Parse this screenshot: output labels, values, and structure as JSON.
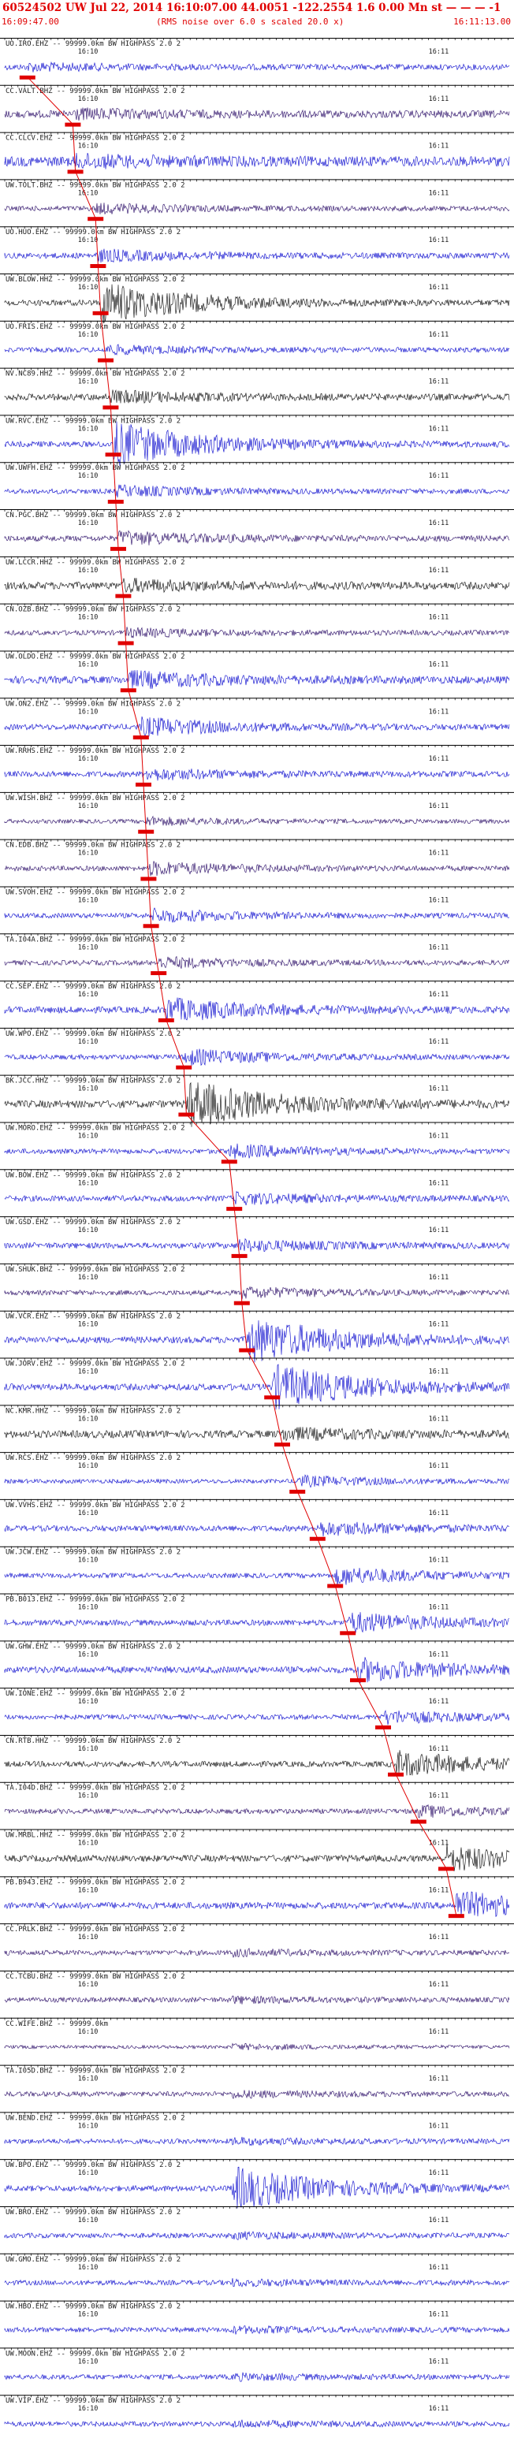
{
  "header": {
    "title": "60524502 UW Jul 22, 2014 16:10:07.00    44.0051 -122.2554  1.6 0.00 Mn st  — — — -1",
    "subtitle": "(RMS noise over 6.0 s scaled 20.0 x)",
    "start_time": "16:09:47.00",
    "end_time": "16:11:13.00"
  },
  "colors": {
    "trace_a": "#0000cc",
    "trace_b": "#200060",
    "trace_c": "#000000",
    "pick": "#e00000",
    "label": "#222222"
  },
  "chart_data": {
    "type": "line",
    "title": "60524502 UW Jul 22, 2014 16:10:07.00    44.0051 -122.2554  1.6 0.00 Mn st  — — — -1",
    "x_range": [
      "16:09:47.00",
      "16:11:13.00"
    ],
    "tick_labels": [
      "16:10",
      "16:11"
    ],
    "stations": [
      {
        "label": "UO.IRO.EHZ -- 99999.0km BW  HIGHPASS  2.0  2",
        "amp": 0.35,
        "burst": 0.12,
        "pick": 0.045,
        "color": "a"
      },
      {
        "label": "CC.VALT.BHZ -- 99999.0km BW  HIGHPASS  2.0  2",
        "amp": 0.45,
        "burst": 0.16,
        "pick": 0.135,
        "color": "b"
      },
      {
        "label": "CC.CLCV.EHZ -- 99999.0km BW  HIGHPASS  2.0  2",
        "amp": 0.6,
        "burst": 0.18,
        "pick": 0.14,
        "color": "a"
      },
      {
        "label": "UW.TOLT.BHZ -- 99999.0km BW  HIGHPASS  2.0  2",
        "amp": 0.3,
        "burst": 0.17,
        "pick": 0.18,
        "color": "b"
      },
      {
        "label": "UO.HUO.EHZ -- 99999.0km BW  HIGHPASS  2.0  2",
        "amp": 0.35,
        "burst": 0.2,
        "pick": 0.185,
        "color": "a"
      },
      {
        "label": "UW.BLOW.HHZ -- 99999.0km BW  HIGHPASS  2.0  2",
        "amp": 0.35,
        "burst": 0.85,
        "pick": 0.19,
        "color": "c"
      },
      {
        "label": "UO.FRIS.EHZ -- 99999.0km BW  HIGHPASS  2.0  2",
        "amp": 0.3,
        "burst": 0.15,
        "pick": 0.2,
        "color": "a"
      },
      {
        "label": "NV.NC89.HHZ -- 99999.0km BW  HIGHPASS  2.0  2",
        "amp": 0.4,
        "burst": 0.2,
        "pick": 0.21,
        "color": "c"
      },
      {
        "label": "UW.RVC.EHZ -- 99999.0km BW  HIGHPASS  2.0  2",
        "amp": 0.35,
        "burst": 0.9,
        "pick": 0.215,
        "color": "a"
      },
      {
        "label": "UW.UWFH.EHZ -- 99999.0km BW  HIGHPASS  2.0  2",
        "amp": 0.3,
        "burst": 0.2,
        "pick": 0.22,
        "color": "a"
      },
      {
        "label": "CN.PGC.BHZ -- 99999.0km BW  HIGHPASS  2.0  2",
        "amp": 0.35,
        "burst": 0.25,
        "pick": 0.225,
        "color": "b"
      },
      {
        "label": "UW.LCCR.HHZ -- 99999.0km BW  HIGHPASS  2.0  2",
        "amp": 0.45,
        "burst": 0.2,
        "pick": 0.235,
        "color": "c"
      },
      {
        "label": "CN.OZB.BHZ -- 99999.0km BW  HIGHPASS  2.0  2",
        "amp": 0.3,
        "burst": 0.15,
        "pick": 0.24,
        "color": "b"
      },
      {
        "label": "UW.OLDO.EHZ -- 99999.0km BW  HIGHPASS  2.0  2",
        "amp": 0.45,
        "burst": 0.3,
        "pick": 0.245,
        "color": "a"
      },
      {
        "label": "UW.ON2.EHZ -- 99999.0km BW  HIGHPASS  2.0  2",
        "amp": 0.35,
        "burst": 0.35,
        "pick": 0.27,
        "color": "a"
      },
      {
        "label": "UW.RRHS.EHZ -- 99999.0km BW  HIGHPASS  2.0  2",
        "amp": 0.35,
        "burst": 0.2,
        "pick": 0.275,
        "color": "a"
      },
      {
        "label": "UW.WISH.BHZ -- 99999.0km BW  HIGHPASS  2.0  2",
        "amp": 0.25,
        "burst": 0.15,
        "pick": 0.28,
        "color": "b"
      },
      {
        "label": "CN.EDB.BHZ -- 99999.0km BW  HIGHPASS  2.0  2",
        "amp": 0.3,
        "burst": 0.25,
        "pick": 0.285,
        "color": "b"
      },
      {
        "label": "UW.SVOH.EHZ -- 99999.0km BW  HIGHPASS  2.0  2",
        "amp": 0.3,
        "burst": 0.25,
        "pick": 0.29,
        "color": "a"
      },
      {
        "label": "TA.I04A.BHZ -- 99999.0km BW  HIGHPASS  2.0  2",
        "amp": 0.3,
        "burst": 0.2,
        "pick": 0.305,
        "color": "b"
      },
      {
        "label": "CC.SEP.EHZ -- 99999.0km BW  HIGHPASS  2.0  2",
        "amp": 0.4,
        "burst": 0.45,
        "pick": 0.32,
        "color": "a"
      },
      {
        "label": "UW.WPO.EHZ -- 99999.0km BW  HIGHPASS  2.0  2",
        "amp": 0.3,
        "burst": 0.3,
        "pick": 0.355,
        "color": "a"
      },
      {
        "label": "BK.JCC.HHZ -- 99999.0km BW  HIGHPASS  2.0  2",
        "amp": 0.45,
        "burst": 0.95,
        "pick": 0.36,
        "color": "c"
      },
      {
        "label": "UW.MORO.EHZ -- 99999.0km BW  HIGHPASS  2.0  2",
        "amp": 0.3,
        "burst": 0.25,
        "pick": 0.445,
        "color": "a"
      },
      {
        "label": "UW.BOW.EHZ -- 99999.0km BW  HIGHPASS  2.0  2",
        "amp": 0.35,
        "burst": 0.2,
        "pick": 0.455,
        "color": "a"
      },
      {
        "label": "UW.GSD.EHZ -- 99999.0km BW  HIGHPASS  2.0  2",
        "amp": 0.35,
        "burst": 0.2,
        "pick": 0.465,
        "color": "a"
      },
      {
        "label": "UW.SHUK.BHZ -- 99999.0km BW  HIGHPASS  2.0  2",
        "amp": 0.3,
        "burst": 0.2,
        "pick": 0.47,
        "color": "b"
      },
      {
        "label": "UW.VCR.EHZ -- 99999.0km BW  HIGHPASS  2.0  2",
        "amp": 0.4,
        "burst": 0.95,
        "pick": 0.48,
        "color": "a"
      },
      {
        "label": "UW.JORV.EHZ -- 99999.0km BW  HIGHPASS  2.0  2",
        "amp": 0.4,
        "burst": 0.9,
        "pick": 0.53,
        "color": "a"
      },
      {
        "label": "NC.KMR.HHZ -- 99999.0km BW  HIGHPASS  2.0  2",
        "amp": 0.45,
        "burst": 0.2,
        "pick": 0.55,
        "color": "c"
      },
      {
        "label": "UW.RCS.EHZ -- 99999.0km BW  HIGHPASS  2.0  2",
        "amp": 0.25,
        "burst": 0.2,
        "pick": 0.58,
        "color": "a"
      },
      {
        "label": "UW.VVHS.EHZ -- 99999.0km BW  HIGHPASS  2.0  2",
        "amp": 0.35,
        "burst": 0.25,
        "pick": 0.62,
        "color": "a"
      },
      {
        "label": "UW.JCW.EHZ -- 99999.0km BW  HIGHPASS  2.0  2",
        "amp": 0.3,
        "burst": 0.35,
        "pick": 0.655,
        "color": "a"
      },
      {
        "label": "PB.B013.EHZ -- 99999.0km BW  HIGHPASS  2.0  2",
        "amp": 0.35,
        "burst": 0.4,
        "pick": 0.68,
        "color": "a"
      },
      {
        "label": "UW.GHW.EHZ -- 99999.0km BW  HIGHPASS  2.0  2",
        "amp": 0.4,
        "burst": 0.45,
        "pick": 0.7,
        "color": "a"
      },
      {
        "label": "UW.IONE.EHZ -- 99999.0km BW  HIGHPASS  2.0  2",
        "amp": 0.3,
        "burst": 0.25,
        "pick": 0.75,
        "color": "a"
      },
      {
        "label": "CN.RTB.HHZ -- 99999.0km BW  HIGHPASS  2.0  2",
        "amp": 0.35,
        "burst": 0.5,
        "pick": 0.775,
        "color": "c"
      },
      {
        "label": "TA.I04D.BHZ -- 99999.0km BW  HIGHPASS  2.0  2",
        "amp": 0.3,
        "burst": 0.2,
        "pick": 0.82,
        "color": "b"
      },
      {
        "label": "UW.MRBL.HHZ -- 99999.0km BW  HIGHPASS  2.0  2",
        "amp": 0.4,
        "burst": 0.5,
        "pick": 0.875,
        "color": "c"
      },
      {
        "label": "PB.B943.EHZ -- 99999.0km BW  HIGHPASS  2.0  2",
        "amp": 0.4,
        "burst": 0.55,
        "pick": 0.895,
        "color": "a"
      },
      {
        "label": "CC.PRLK.BHZ -- 99999.0km BW  HIGHPASS  2.0  2",
        "amp": 0.3,
        "burst": 0.1,
        "pick": null,
        "color": "b"
      },
      {
        "label": "CC.TCBU.BHZ -- 99999.0km BW  HIGHPASS  2.0  2",
        "amp": 0.3,
        "burst": 0.1,
        "pick": null,
        "color": "b"
      },
      {
        "label": "CC.WIFE.BHZ -- 99999.0km",
        "amp": 0.2,
        "burst": 0.1,
        "pick": null,
        "color": "b"
      },
      {
        "label": "TA.I05D.BHZ -- 99999.0km BW  HIGHPASS  2.0  2",
        "amp": 0.3,
        "burst": 0.1,
        "pick": null,
        "color": "b"
      },
      {
        "label": "UW.BEND.EHZ -- 99999.0km BW  HIGHPASS  2.0  2",
        "amp": 0.3,
        "burst": 0.1,
        "pick": null,
        "color": "a"
      },
      {
        "label": "UW.BPO.EHZ -- 99999.0km BW  HIGHPASS  2.0  2",
        "amp": 0.35,
        "burst": 0.9,
        "pick": null,
        "color": "a"
      },
      {
        "label": "UW.BRO.EHZ -- 99999.0km BW  HIGHPASS  2.0  2",
        "amp": 0.3,
        "burst": 0.1,
        "pick": null,
        "color": "a"
      },
      {
        "label": "UW.GMO.EHZ -- 99999.0km BW  HIGHPASS  2.0  2",
        "amp": 0.3,
        "burst": 0.1,
        "pick": null,
        "color": "a"
      },
      {
        "label": "UW.HBO.EHZ -- 99999.0km BW  HIGHPASS  2.0  2",
        "amp": 0.3,
        "burst": 0.1,
        "pick": null,
        "color": "a"
      },
      {
        "label": "UW.MOON.EHZ -- 99999.0km BW  HIGHPASS  2.0  2",
        "amp": 0.3,
        "burst": 0.1,
        "pick": null,
        "color": "a"
      },
      {
        "label": "UW.VIP.EHZ -- 99999.0km BW  HIGHPASS  2.0  2",
        "amp": 0.3,
        "burst": 0.1,
        "pick": null,
        "color": "a"
      }
    ]
  }
}
